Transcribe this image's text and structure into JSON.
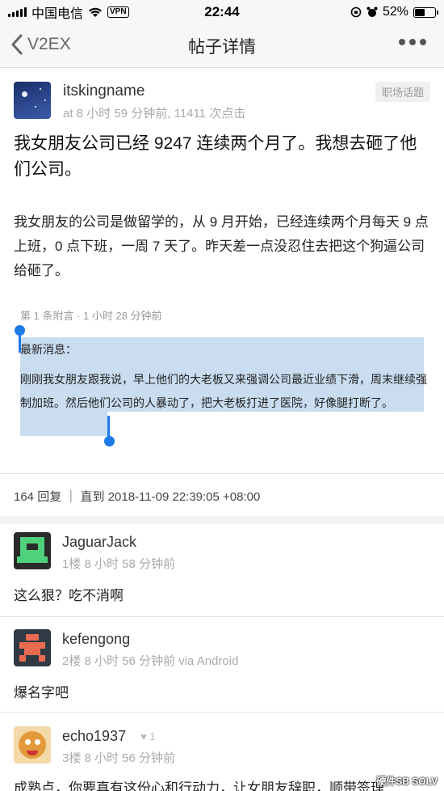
{
  "status_bar": {
    "carrier": "中国电信",
    "vpn": "VPN",
    "time": "22:44",
    "battery": "52%",
    "battery_level": 0.52
  },
  "nav": {
    "back_label": "V2EX",
    "title": "帖子详情"
  },
  "topic": {
    "author": "itskingname",
    "meta": "at 8 小时 59 分钟前, 11411 次点击",
    "tag": "职场话题",
    "title": "我女朋友公司已经 9247 连续两个月了。我想去砸了他们公司。",
    "body": "我女朋友的公司是做留学的，从 9 月开始，已经连续两个月每天 9 点上班，0 点下班，一周 7 天了。昨天差一点没忍住去把这个狗逼公司给砸了。",
    "append_meta": "第 1 条附言 · 1 小时 28 分钟前",
    "append_line1": "最新消息：",
    "append_line2": "刚刚我女朋友跟我说，早上他们的大老板又来强调公司最近业绩下滑，周末继续强制加班。然后他们公司的人暴动了，把大老板打进了医院，好像腿打断了。",
    "reply_stat": "164 回复 ｜ 直到 2018-11-09 22:39:05 +08:00"
  },
  "replies": [
    {
      "name": "JaguarJack",
      "meta": "1楼  8 小时 58 分钟前",
      "content": "这么狠？吃不消啊"
    },
    {
      "name": "kefengong",
      "meta": "2楼  8 小时 56 分钟前 via Android",
      "content": "爆名字吧"
    },
    {
      "name": "echo1937",
      "likes": "1",
      "meta": "3楼  8 小时 56 分钟前",
      "content": "成熟点，你要真有这份心和行动力，让女朋友辞职，顺带签理"
    }
  ],
  "watermark": "硬件SB SOLV"
}
